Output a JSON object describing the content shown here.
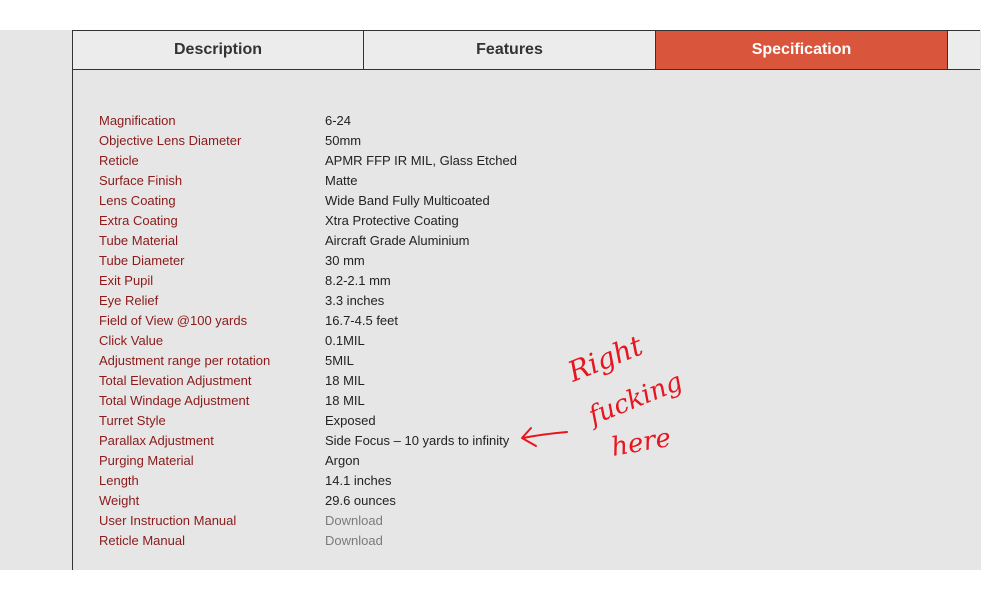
{
  "colors": {
    "accent": "#d9553b",
    "label": "#8b1a1a",
    "highlight": "#e6f000",
    "annotation": "#e8141e"
  },
  "tabs": [
    {
      "label": "Description",
      "active": false
    },
    {
      "label": "Features",
      "active": false
    },
    {
      "label": "Specification",
      "active": true
    }
  ],
  "specs": [
    {
      "label": "Magnification",
      "value": "6-24"
    },
    {
      "label": "Objective Lens Diameter",
      "value": "50mm"
    },
    {
      "label": "Reticle",
      "value": "APMR FFP IR MIL, Glass Etched"
    },
    {
      "label": "Surface Finish",
      "value": "Matte"
    },
    {
      "label": "Lens Coating",
      "value": "Wide Band Fully Multicoated"
    },
    {
      "label": "Extra Coating",
      "value": "Xtra Protective Coating"
    },
    {
      "label": "Tube Material",
      "value": "Aircraft Grade Aluminium"
    },
    {
      "label": "Tube Diameter",
      "value": "30 mm"
    },
    {
      "label": "Exit Pupil",
      "value": "8.2-2.1 mm"
    },
    {
      "label": "Eye Relief",
      "value": "3.3 inches"
    },
    {
      "label": "Field of View @100 yards",
      "value": "16.7-4.5 feet"
    },
    {
      "label": "Click Value",
      "value": "0.1MIL"
    },
    {
      "label": "Adjustment range per rotation",
      "value": "5MIL"
    },
    {
      "label": "Total Elevation Adjustment",
      "value": "18 MIL"
    },
    {
      "label": "Total Windage Adjustment",
      "value": "18 MIL"
    },
    {
      "label": "Turret Style",
      "value": "Exposed"
    },
    {
      "label": "Parallax Adjustment",
      "value": "Side Focus – 10 yards to infinity",
      "highlighted": true
    },
    {
      "label": "Purging Material",
      "value": "Argon"
    },
    {
      "label": "Length",
      "value": "14.1 inches"
    },
    {
      "label": "Weight",
      "value": "29.6 ounces"
    },
    {
      "label": "User Instruction Manual",
      "value": "Download",
      "link": true
    },
    {
      "label": "Reticle Manual",
      "value": "Download",
      "link": true
    }
  ],
  "annotation": {
    "line1": "Right",
    "line2": "fucking",
    "line3": "here"
  }
}
